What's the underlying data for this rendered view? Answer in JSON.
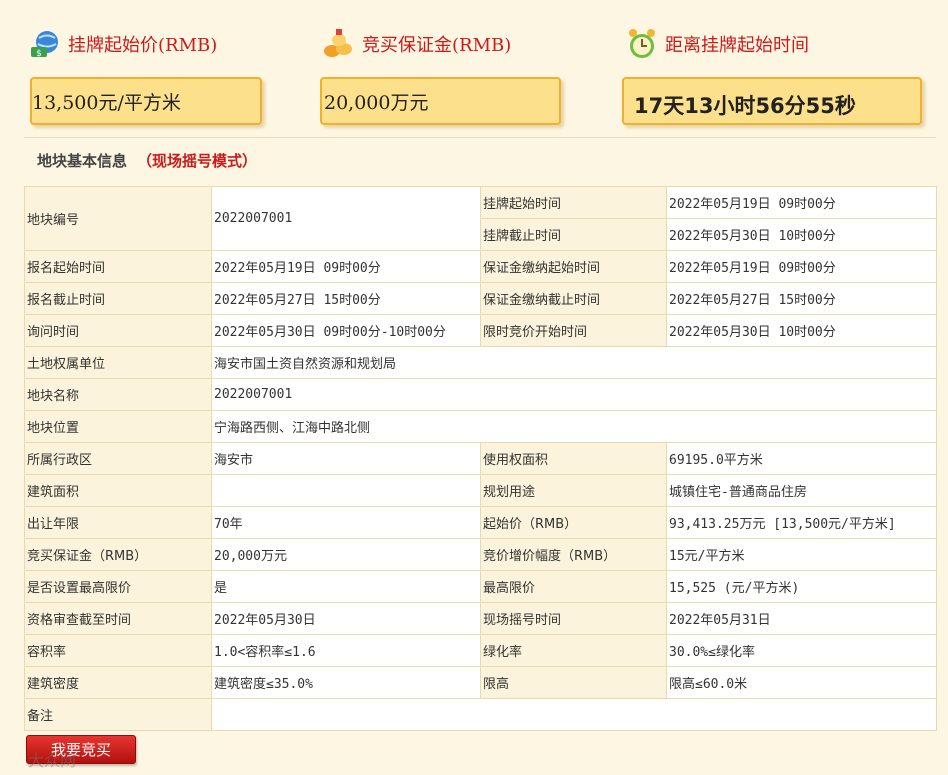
{
  "header": {
    "start_price_label": "挂牌起始价(RMB)",
    "start_price_value": "13,500元/平方米",
    "deposit_label": "竞买保证金(RMB)",
    "deposit_value": "20,000万元",
    "countdown_label": "距离挂牌起始时间",
    "countdown_value": "17天13小时56分55秒"
  },
  "section": {
    "title": "地块基本信息",
    "mode": "（现场摇号模式）"
  },
  "table": {
    "parcel_no_label": "地块编号",
    "parcel_no_value": "2022007001",
    "listing_start_label": "挂牌起始时间",
    "listing_start_value": "2022年05月19日 09时00分",
    "listing_end_label": "挂牌截止时间",
    "listing_end_value": "2022年05月30日 10时00分",
    "reg_start_label": "报名起始时间",
    "reg_start_value": "2022年05月19日 09时00分",
    "dep_start_label": "保证金缴纳起始时间",
    "dep_start_value": "2022年05月19日 09时00分",
    "reg_end_label": "报名截止时间",
    "reg_end_value": "2022年05月27日 15时00分",
    "dep_end_label": "保证金缴纳截止时间",
    "dep_end_value": "2022年05月27日 15时00分",
    "inquiry_label": "询问时间",
    "inquiry_value": "2022年05月30日 09时00分-10时00分",
    "timed_bid_label": "限时竞价开始时间",
    "timed_bid_value": "2022年05月30日 10时00分",
    "owner_label": "土地权属单位",
    "owner_value": "海安市国土资自然资源和规划局",
    "name_label": "地块名称",
    "name_value": "2022007001",
    "location_label": "地块位置",
    "location_value": "宁海路西侧、江海中路北侧",
    "district_label": "所属行政区",
    "district_value": "海安市",
    "use_area_label": "使用权面积",
    "use_area_value": "69195.0平方米",
    "build_area_label": "建筑面积",
    "build_area_value": "",
    "planned_use_label": "规划用途",
    "planned_use_value": "城镇住宅-普通商品住房",
    "term_label": "出让年限",
    "term_value": "70年",
    "start_price_label": "起始价（RMB）",
    "start_price_value": "93,413.25万元 [13,500元/平方米]",
    "deposit_label": "竞买保证金（RMB）",
    "deposit_value": "20,000万元",
    "increment_label": "竞价增价幅度（RMB）",
    "increment_value": "15元/平方米",
    "max_set_label": "是否设置最高限价",
    "max_set_value": "是",
    "max_price_label": "最高限价",
    "max_price_value": "15,525 (元/平方米)",
    "qual_label": "资格审查截至时间",
    "qual_value": "2022年05月30日",
    "lottery_label": "现场摇号时间",
    "lottery_value": "2022年05月31日",
    "far_label": "容积率",
    "far_value": "1.0<容积率≤1.6",
    "green_label": "绿化率",
    "green_value": "30.0%≤绿化率",
    "density_label": "建筑密度",
    "density_value": "建筑密度≤35.0%",
    "height_label": "限高",
    "height_value": "限高≤60.0米",
    "remark_label": "备注",
    "remark_value": ""
  },
  "actions": {
    "bid_label": "我要竞买"
  },
  "watermark": "大众网",
  "icons": {
    "price": "money-globe-icon",
    "deposit": "coins-icon",
    "countdown": "alarm-clock-icon"
  },
  "colors": {
    "accent_red": "#cc1a1a",
    "box_fill": "#fde08c",
    "box_border": "#f0b030",
    "button_red": "#d52420"
  }
}
